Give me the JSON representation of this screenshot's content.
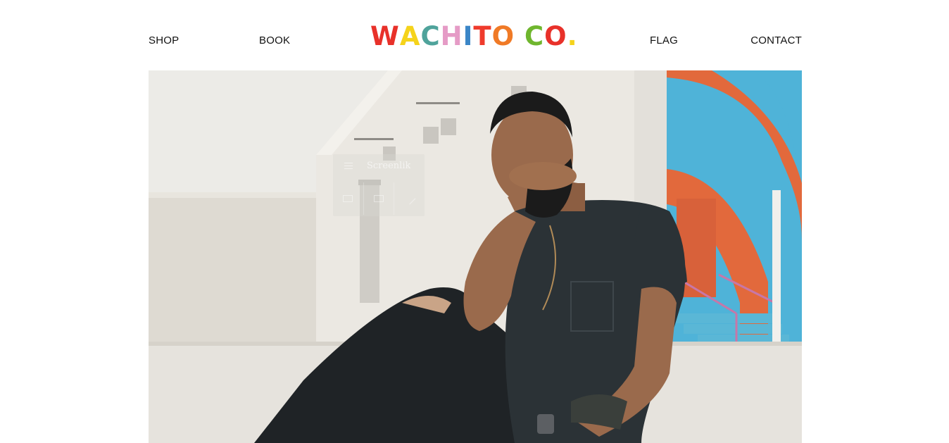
{
  "nav": {
    "left": [
      {
        "label": "SHOP"
      },
      {
        "label": "BOOK"
      }
    ],
    "right": [
      {
        "label": "FLAG"
      },
      {
        "label": "CONTACT"
      }
    ]
  },
  "logo": {
    "text": "WACHITO CO.",
    "letters": [
      {
        "char": "W",
        "color": "#e8312a"
      },
      {
        "char": "A",
        "color": "#f5d31b"
      },
      {
        "char": "C",
        "color": "#4fa39b"
      },
      {
        "char": "H",
        "color": "#e59bc6"
      },
      {
        "char": "I",
        "color": "#3b86c7"
      },
      {
        "char": "T",
        "color": "#ef3b2c"
      },
      {
        "char": "O",
        "color": "#f07a26"
      },
      {
        "char": " ",
        "color": "#000000"
      },
      {
        "char": "C",
        "color": "#6fb62e"
      },
      {
        "char": "O",
        "color": "#e8312a"
      },
      {
        "char": ".",
        "color": "#f5d31b"
      }
    ]
  },
  "hero": {
    "image": "man-sitting-rooftop-photo",
    "overlay_widget": {
      "title": "Screenlik",
      "icons": [
        "menu-icon",
        "monitor-icon",
        "window-icon",
        "pen-icon"
      ]
    }
  }
}
